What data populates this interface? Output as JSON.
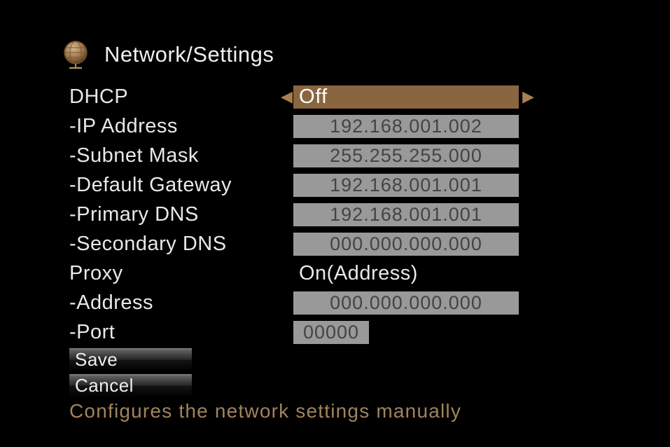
{
  "header": {
    "title": "Network/Settings"
  },
  "rows": {
    "dhcp": {
      "label": "DHCP",
      "value": "Off"
    },
    "ip": {
      "label": "-IP Address",
      "value": "192.168.001.002"
    },
    "subnet": {
      "label": "-Subnet Mask",
      "value": "255.255.255.000"
    },
    "gateway": {
      "label": "-Default Gateway",
      "value": "192.168.001.001"
    },
    "dns1": {
      "label": "-Primary DNS",
      "value": "192.168.001.001"
    },
    "dns2": {
      "label": "-Secondary DNS",
      "value": "000.000.000.000"
    },
    "proxy": {
      "label": "Proxy",
      "value": "On(Address)"
    },
    "address": {
      "label": "-Address",
      "value": "000.000.000.000"
    },
    "port": {
      "label": "-Port",
      "value": "00000"
    }
  },
  "buttons": {
    "save": "Save",
    "cancel": "Cancel"
  },
  "hint": "Configures the network settings manually"
}
